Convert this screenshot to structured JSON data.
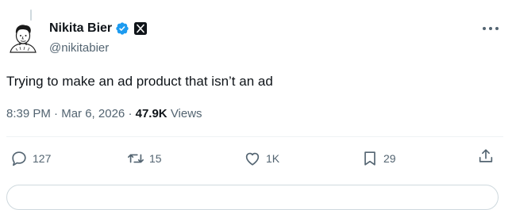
{
  "tweet": {
    "author": {
      "display_name": "Nikita Bier",
      "handle": "@nikitabier",
      "verified_icon": "verified-badge-icon",
      "affiliation_icon": "x-logo-icon"
    },
    "text": "Trying to make an ad product that isn’t an ad",
    "time": "8:39 PM",
    "separator": "·",
    "date": "Mar 6, 2026",
    "views_count": "47.9K",
    "views_label": "Views"
  },
  "actions": {
    "reply": {
      "icon": "reply-icon",
      "count": "127"
    },
    "repost": {
      "icon": "repost-icon",
      "count": "15"
    },
    "like": {
      "icon": "heart-icon",
      "count": "1K"
    },
    "bookmark": {
      "icon": "bookmark-icon",
      "count": "29"
    },
    "share": {
      "icon": "share-icon"
    }
  },
  "colors": {
    "verified": "#1d9bf0",
    "secondary_text": "#536471",
    "primary_text": "#0f1419",
    "divider": "#eff3f4"
  }
}
